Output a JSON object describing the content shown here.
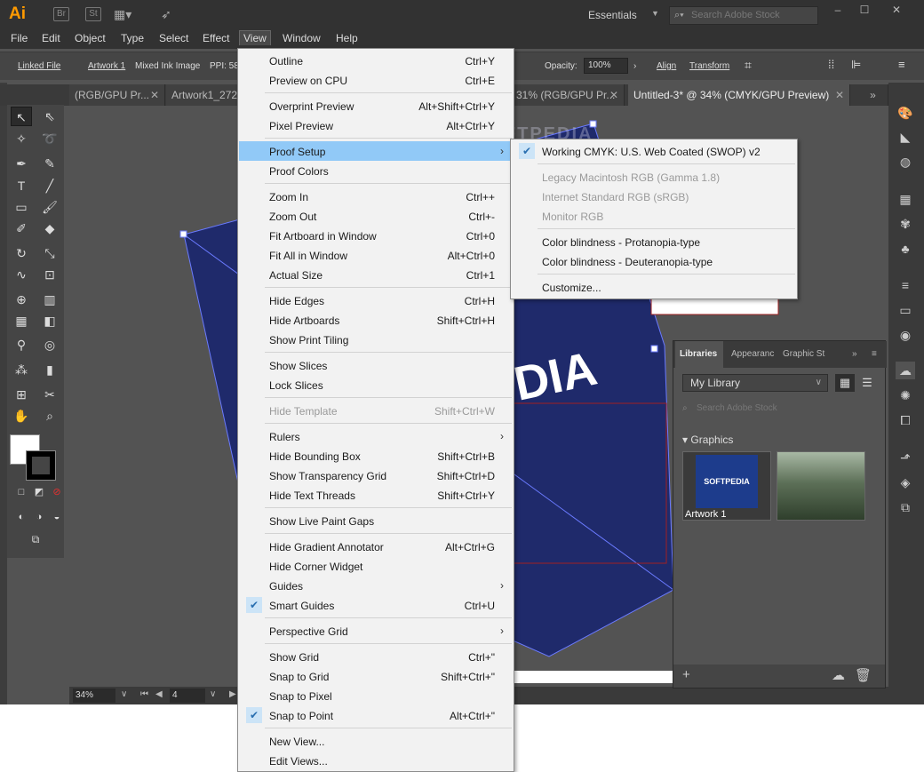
{
  "app": {
    "logo": "Ai",
    "br": "Br",
    "st": "St",
    "workspace": "Essentials",
    "stock_placeholder": "Search Adobe Stock"
  },
  "menubar": [
    "File",
    "Edit",
    "Object",
    "Type",
    "Select",
    "Effect",
    "View",
    "Window",
    "Help"
  ],
  "control": {
    "linked_file": "Linked File",
    "artwork": "Artwork 1",
    "mixed_ink": "Mixed Ink Image",
    "ppi": "PPI: 58",
    "opacity_label": "Opacity:",
    "opacity_value": "100%",
    "align": "Align",
    "transform": "Transform"
  },
  "tabs": [
    {
      "label": "(RGB/GPU Pr..."
    },
    {
      "label": "Artwork1_272..."
    },
    {
      "label": "31% (RGB/GPU Pr..."
    },
    {
      "label": "Untitled-3* @ 34% (CMYK/GPU Preview)"
    }
  ],
  "status": {
    "zoom": "34%",
    "page": "4"
  },
  "canvas_text": {
    "brand": "DIA"
  },
  "watermark": "SOFTPEDIA",
  "libraries": {
    "tabs": [
      "Libraries",
      "Appearanc",
      "Graphic St"
    ],
    "library": "My Library",
    "search": "Search Adobe Stock",
    "section": "Graphics",
    "thumb1_text": "SOFTPEDIA",
    "thumb1_caption": "Artwork 1"
  },
  "view_menu": [
    {
      "label": "Outline",
      "shortcut": "Ctrl+Y"
    },
    {
      "label": "Preview on CPU",
      "shortcut": "Ctrl+E"
    },
    {
      "label": "Overprint Preview",
      "shortcut": "Alt+Shift+Ctrl+Y"
    },
    {
      "label": "Pixel Preview",
      "shortcut": "Alt+Ctrl+Y"
    },
    {
      "label": "Proof Setup",
      "shortcut": ""
    },
    {
      "label": "Proof Colors",
      "shortcut": ""
    },
    {
      "label": "Zoom In",
      "shortcut": "Ctrl++"
    },
    {
      "label": "Zoom Out",
      "shortcut": "Ctrl+-"
    },
    {
      "label": "Fit Artboard in Window",
      "shortcut": "Ctrl+0"
    },
    {
      "label": "Fit All in Window",
      "shortcut": "Alt+Ctrl+0"
    },
    {
      "label": "Actual Size",
      "shortcut": "Ctrl+1"
    },
    {
      "label": "Hide Edges",
      "shortcut": "Ctrl+H"
    },
    {
      "label": "Hide Artboards",
      "shortcut": "Shift+Ctrl+H"
    },
    {
      "label": "Show Print Tiling",
      "shortcut": ""
    },
    {
      "label": "Show Slices",
      "shortcut": ""
    },
    {
      "label": "Lock Slices",
      "shortcut": ""
    },
    {
      "label": "Hide Template",
      "shortcut": "Shift+Ctrl+W"
    },
    {
      "label": "Rulers",
      "shortcut": ""
    },
    {
      "label": "Hide Bounding Box",
      "shortcut": "Shift+Ctrl+B"
    },
    {
      "label": "Show Transparency Grid",
      "shortcut": "Shift+Ctrl+D"
    },
    {
      "label": "Hide Text Threads",
      "shortcut": "Shift+Ctrl+Y"
    },
    {
      "label": "Show Live Paint Gaps",
      "shortcut": ""
    },
    {
      "label": "Hide Gradient Annotator",
      "shortcut": "Alt+Ctrl+G"
    },
    {
      "label": "Hide Corner Widget",
      "shortcut": ""
    },
    {
      "label": "Guides",
      "shortcut": ""
    },
    {
      "label": "Smart Guides",
      "shortcut": "Ctrl+U"
    },
    {
      "label": "Perspective Grid",
      "shortcut": ""
    },
    {
      "label": "Show Grid",
      "shortcut": "Ctrl+\""
    },
    {
      "label": "Snap to Grid",
      "shortcut": "Shift+Ctrl+\""
    },
    {
      "label": "Snap to Pixel",
      "shortcut": ""
    },
    {
      "label": "Snap to Point",
      "shortcut": "Alt+Ctrl+\""
    },
    {
      "label": "New View...",
      "shortcut": ""
    },
    {
      "label": "Edit Views...",
      "shortcut": ""
    }
  ],
  "proof_submenu": [
    {
      "label": "Working CMYK: U.S. Web Coated (SWOP) v2"
    },
    {
      "label": "Legacy Macintosh RGB (Gamma 1.8)"
    },
    {
      "label": "Internet Standard RGB (sRGB)"
    },
    {
      "label": "Monitor RGB"
    },
    {
      "label": "Color blindness - Protanopia-type"
    },
    {
      "label": "Color blindness - Deuteranopia-type"
    },
    {
      "label": "Customize..."
    }
  ],
  "colors": {
    "menu_highlight": "#91c9f7",
    "artwork": "#1f2a6b",
    "accent": "#ff9a00"
  }
}
